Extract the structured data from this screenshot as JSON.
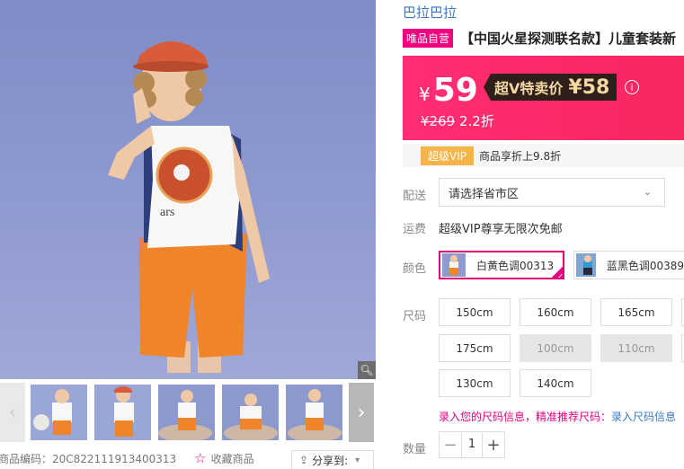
{
  "gallery": {
    "zoom_icon": "magnifier-icon",
    "prev_icon": "chevron-left-icon",
    "next_icon": "chevron-right-icon",
    "thumbnail_count": 5
  },
  "meta": {
    "code": "商品编码：20C822111913400313",
    "favorite": "收藏商品",
    "share": "分享到:",
    "share_caret": "▾"
  },
  "product": {
    "brand": "巴拉巴拉",
    "badge": "唯品自营",
    "title": "【中国火星探测联名款】儿童套装新"
  },
  "price": {
    "currency": "¥",
    "now": "59",
    "vip_label": "超V特卖价",
    "vip_price": "¥58",
    "info_icon": "i",
    "original": "¥269",
    "discount": "2.2折"
  },
  "vip": {
    "chip": "超级VIP",
    "desc": "商品享折上9.8折"
  },
  "delivery": {
    "label": "配送",
    "region_value": "请选择省市区",
    "chevron": "⌄"
  },
  "shipping": {
    "label": "运费",
    "text": "超级VIP尊享无限次免邮"
  },
  "colors": {
    "label": "颜色",
    "options": [
      {
        "label": "白黄色调00313",
        "selected": true
      },
      {
        "label": "蓝黑色调00389",
        "selected": false
      }
    ]
  },
  "sizes": {
    "label": "尺码",
    "options": [
      {
        "label": "150cm",
        "available": true
      },
      {
        "label": "160cm",
        "available": true
      },
      {
        "label": "165cm",
        "available": true
      },
      {
        "label": "175cm",
        "available": true
      },
      {
        "label": "100cm",
        "available": false
      },
      {
        "label": "110cm",
        "available": false
      },
      {
        "label": "130cm",
        "available": true
      },
      {
        "label": "140cm",
        "available": true
      }
    ],
    "hint": "录入您的尺码信息，精准推荐尺码：",
    "hint_link": "录入尺码信息"
  },
  "quantity": {
    "label": "数量",
    "value": "1",
    "minus": "−",
    "plus": "+"
  },
  "colors_palette": {
    "brand_pink": "#f10180",
    "price_bg": "#f7275f",
    "vip_gold": "#f6b348",
    "link_blue": "#3a78c3"
  }
}
